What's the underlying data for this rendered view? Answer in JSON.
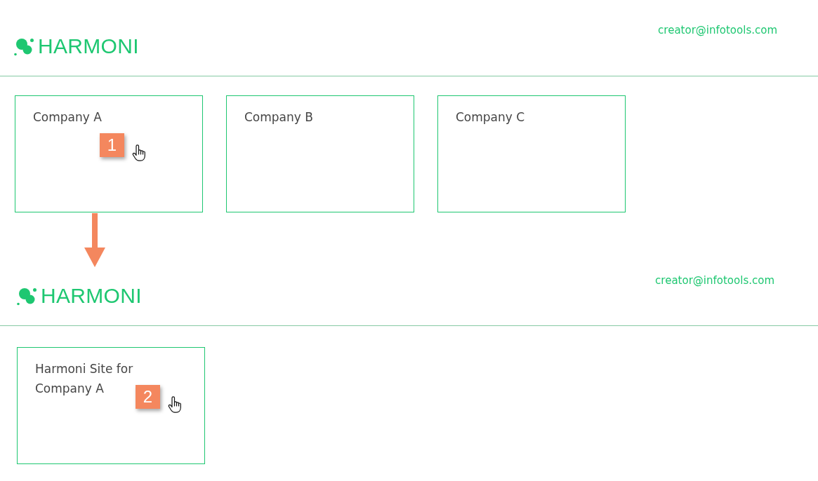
{
  "screens": [
    {
      "header": {
        "logo_text": "HARMONI",
        "user_email": "creator@infotools.com"
      },
      "cards": [
        {
          "title": "Company A",
          "step_badge": "1"
        },
        {
          "title": "Company B"
        },
        {
          "title": "Company C"
        }
      ]
    },
    {
      "header": {
        "logo_text": "HARMONI",
        "user_email": "creator@infotools.com"
      },
      "cards": [
        {
          "title": "Harmoni Site for Company A",
          "step_badge": "2"
        }
      ]
    }
  ]
}
